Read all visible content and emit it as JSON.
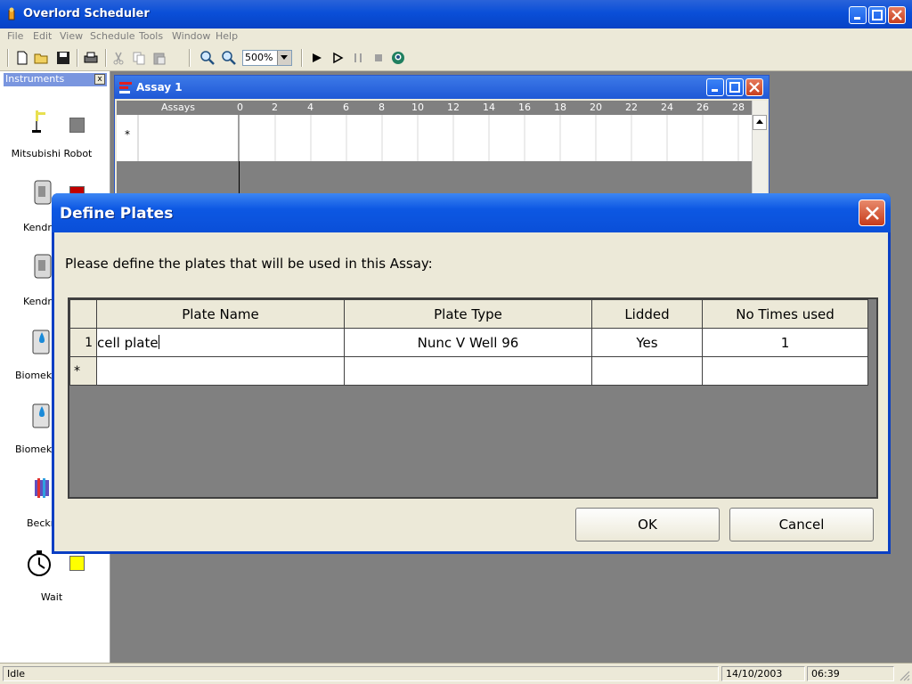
{
  "app": {
    "title": "Overlord Scheduler"
  },
  "menu": [
    "File",
    "Edit",
    "View",
    "Schedule",
    "Tools",
    "Window",
    "Help"
  ],
  "toolbar": {
    "zoom": "500%"
  },
  "instruments": {
    "title": "Instruments",
    "close_glyph": "x",
    "items": [
      {
        "label": "Mitsubishi Robot",
        "icon": "robot-arm-icon",
        "color": "#808080"
      },
      {
        "label": "Kendro",
        "icon": "incubator-icon",
        "color": "#c00000"
      },
      {
        "label": "Kendro",
        "icon": "incubator-icon",
        "color": ""
      },
      {
        "label": "Biomek E",
        "icon": "liquid-handler-icon",
        "color": ""
      },
      {
        "label": "Biomek E",
        "icon": "liquid-handler-icon",
        "color": ""
      },
      {
        "label": "Beckm",
        "icon": "reader-icon",
        "color": ""
      },
      {
        "label": "Wait",
        "icon": "stopwatch-icon",
        "color": "#ffff00"
      }
    ]
  },
  "assay": {
    "title": "Assay 1",
    "column_header": "Assays",
    "ticks": [
      "0",
      "2",
      "4",
      "6",
      "8",
      "10",
      "12",
      "14",
      "16",
      "18",
      "20",
      "22",
      "24",
      "26",
      "28"
    ],
    "new_row_marker": "*"
  },
  "dialog": {
    "title": "Define Plates",
    "prompt": "Please define the plates that will be used in this Assay:",
    "columns": [
      "Plate Name",
      "Plate Type",
      "Lidded",
      "No Times used"
    ],
    "rows": [
      {
        "index": "1",
        "name": "cell plate",
        "type": "Nunc V Well 96",
        "lidded": "Yes",
        "times": "1"
      }
    ],
    "new_row_marker": "*",
    "ok_label": "OK",
    "cancel_label": "Cancel"
  },
  "status": {
    "text": "Idle",
    "date": "14/10/2003",
    "time": "06:39"
  }
}
